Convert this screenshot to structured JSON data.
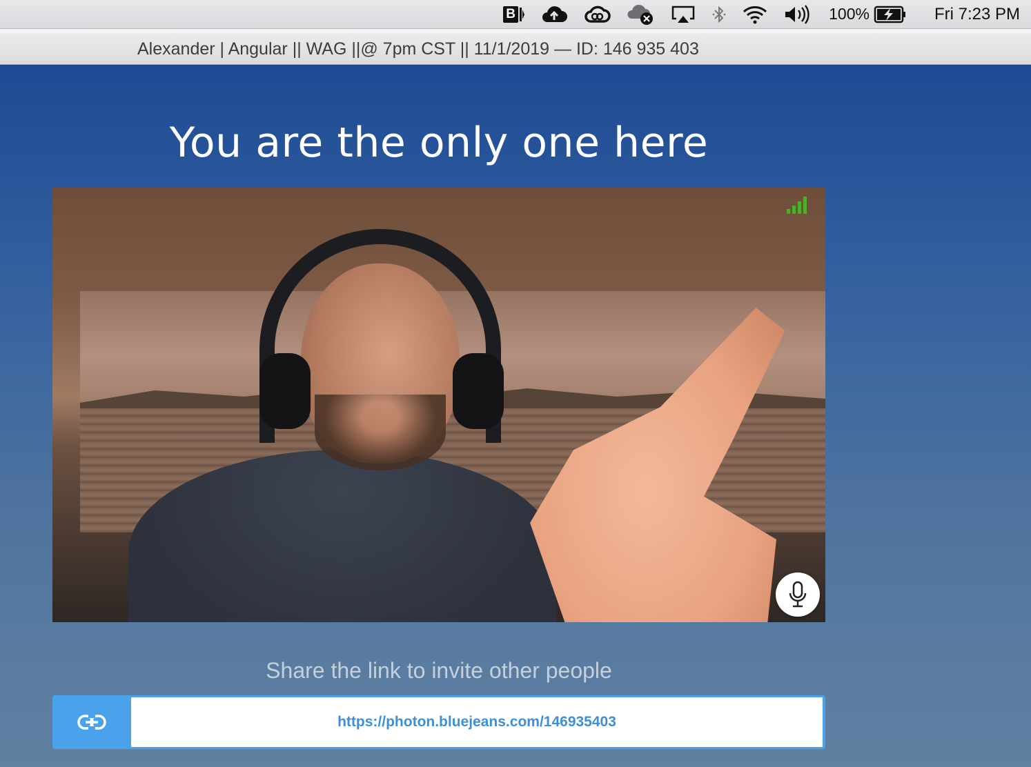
{
  "menubar": {
    "battery_percent": "100%",
    "clock": "Fri 7:23 PM",
    "icons": [
      "bi-icon",
      "cloud-upload-icon",
      "creative-cloud-icon",
      "cloud-offline-icon",
      "airplay-icon",
      "bluetooth-icon",
      "wifi-icon",
      "volume-icon",
      "battery-charging-icon"
    ],
    "bi_label": "B"
  },
  "window": {
    "title": "Alexander | Angular || WAG ||@ 7pm CST || 11/1/2019 — ID: 146 935 403"
  },
  "meeting": {
    "headline": "You are the only one here",
    "signal_strength_bars": 4,
    "signal_color": "#4caf2a"
  },
  "share": {
    "label": "Share the link to invite other people",
    "url": "https://photon.bluejeans.com/146935403",
    "accent_color": "#4aa3ea"
  }
}
